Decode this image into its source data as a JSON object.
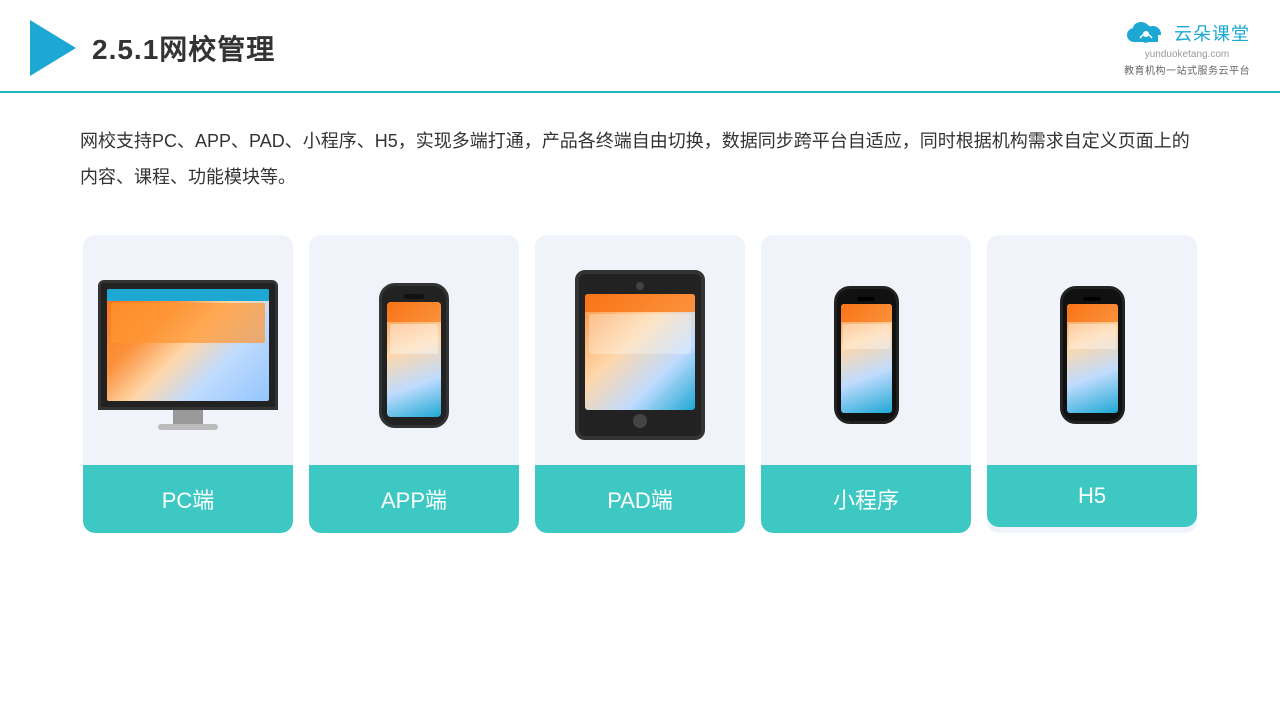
{
  "header": {
    "title": "2.5.1网校管理",
    "brand_name": "云朵课堂",
    "brand_url": "yunduoketang.com",
    "brand_tagline": "教育机构一站式服务云平台"
  },
  "description": {
    "text": "网校支持PC、APP、PAD、小程序、H5，实现多端打通，产品各终端自由切换，数据同步跨平台自适应，同时根据机构需求自定义页面上的内容、课程、功能模块等。"
  },
  "cards": [
    {
      "id": "pc",
      "label": "PC端"
    },
    {
      "id": "app",
      "label": "APP端"
    },
    {
      "id": "pad",
      "label": "PAD端"
    },
    {
      "id": "mini",
      "label": "小程序"
    },
    {
      "id": "h5",
      "label": "H5"
    }
  ],
  "colors": {
    "accent": "#1da8d4",
    "teal": "#3ec8c4",
    "header_line": "#1fb8c1"
  }
}
